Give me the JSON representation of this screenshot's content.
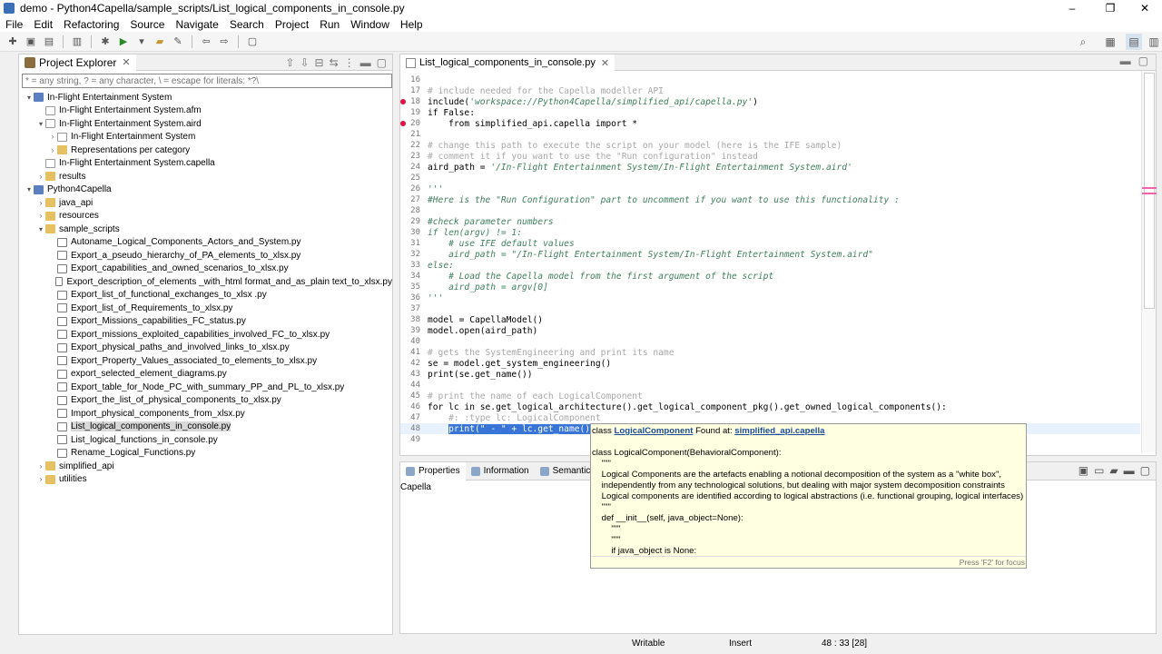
{
  "window": {
    "title": "demo - Python4Capella/sample_scripts/List_logical_components_in_console.py",
    "minimize": "–",
    "maximize": "❐",
    "close": "✕"
  },
  "menu": [
    "File",
    "Edit",
    "Refactoring",
    "Source",
    "Navigate",
    "Search",
    "Project",
    "Run",
    "Window",
    "Help"
  ],
  "project_explorer": {
    "tab_label": "Project Explorer",
    "filter_placeholder": "* = any string, ? = any character, \\ = escape for literals: *?\\",
    "tree": [
      {
        "label": "In-Flight Entertainment System",
        "depth": 0,
        "twisty": "▾",
        "icon": "proj"
      },
      {
        "label": "In-Flight Entertainment System.afm",
        "depth": 1,
        "twisty": "",
        "icon": "file"
      },
      {
        "label": "In-Flight Entertainment System.aird",
        "depth": 1,
        "twisty": "▾",
        "icon": "file"
      },
      {
        "label": "In-Flight Entertainment System",
        "depth": 2,
        "twisty": "›",
        "icon": "file"
      },
      {
        "label": "Representations per category",
        "depth": 2,
        "twisty": "›",
        "icon": "folder"
      },
      {
        "label": "In-Flight Entertainment System.capella",
        "depth": 1,
        "twisty": "",
        "icon": "file"
      },
      {
        "label": "results",
        "depth": 1,
        "twisty": "›",
        "icon": "folder"
      },
      {
        "label": "Python4Capella",
        "depth": 0,
        "twisty": "▾",
        "icon": "proj"
      },
      {
        "label": "java_api",
        "depth": 1,
        "twisty": "›",
        "icon": "folder"
      },
      {
        "label": "resources",
        "depth": 1,
        "twisty": "›",
        "icon": "folder"
      },
      {
        "label": "sample_scripts",
        "depth": 1,
        "twisty": "▾",
        "icon": "folder"
      },
      {
        "label": "Autoname_Logical_Components_Actors_and_System.py",
        "depth": 2,
        "twisty": "",
        "icon": "py"
      },
      {
        "label": "Export_a_pseudo_hierarchy_of_PA_elements_to_xlsx.py",
        "depth": 2,
        "twisty": "",
        "icon": "py"
      },
      {
        "label": "Export_capabilities_and_owned_scenarios_to_xlsx.py",
        "depth": 2,
        "twisty": "",
        "icon": "py"
      },
      {
        "label": "Export_description_of_elements _with_html format_and_as_plain text_to_xlsx.py",
        "depth": 2,
        "twisty": "",
        "icon": "py"
      },
      {
        "label": "Export_list_of_functional_exchanges_to_xlsx .py",
        "depth": 2,
        "twisty": "",
        "icon": "py"
      },
      {
        "label": "Export_list_of_Requirements_to_xlsx.py",
        "depth": 2,
        "twisty": "",
        "icon": "py"
      },
      {
        "label": "Export_Missions_capabilities_FC_status.py",
        "depth": 2,
        "twisty": "",
        "icon": "py"
      },
      {
        "label": "Export_missions_exploited_capabilities_involved_FC_to_xlsx.py",
        "depth": 2,
        "twisty": "",
        "icon": "py"
      },
      {
        "label": "Export_physical_paths_and_involved_links_to_xlsx.py",
        "depth": 2,
        "twisty": "",
        "icon": "py"
      },
      {
        "label": "Export_Property_Values_associated_to_elements_to_xlsx.py",
        "depth": 2,
        "twisty": "",
        "icon": "py"
      },
      {
        "label": "export_selected_element_diagrams.py",
        "depth": 2,
        "twisty": "",
        "icon": "py"
      },
      {
        "label": "Export_table_for_Node_PC_with_summary_PP_and_PL_to_xlsx.py",
        "depth": 2,
        "twisty": "",
        "icon": "py"
      },
      {
        "label": "Export_the_list_of_physical_components_to_xlsx.py",
        "depth": 2,
        "twisty": "",
        "icon": "py"
      },
      {
        "label": "Import_physical_components_from_xlsx.py",
        "depth": 2,
        "twisty": "",
        "icon": "py"
      },
      {
        "label": "List_logical_components_in_console.py",
        "depth": 2,
        "twisty": "",
        "icon": "py",
        "selected": true
      },
      {
        "label": "List_logical_functions_in_console.py",
        "depth": 2,
        "twisty": "",
        "icon": "py"
      },
      {
        "label": "Rename_Logical_Functions.py",
        "depth": 2,
        "twisty": "",
        "icon": "py"
      },
      {
        "label": "simplified_api",
        "depth": 1,
        "twisty": "›",
        "icon": "folder"
      },
      {
        "label": "utilities",
        "depth": 1,
        "twisty": "›",
        "icon": "folder"
      }
    ]
  },
  "editor": {
    "tab_label": "List_logical_components_in_console.py",
    "lines": [
      {
        "n": "16",
        "parts": [
          {
            "t": "",
            "c": ""
          }
        ]
      },
      {
        "n": "17",
        "parts": [
          {
            "t": "# include needed for the Capella modeller API",
            "c": "c-gray"
          }
        ]
      },
      {
        "n": "18",
        "marker": true,
        "parts": [
          {
            "t": "include(",
            "c": ""
          },
          {
            "t": "'workspace://Python4Capella/simplified_api/capella.py'",
            "c": "c-green"
          },
          {
            "t": ")",
            "c": ""
          }
        ]
      },
      {
        "n": "19",
        "parts": [
          {
            "t": "if False:",
            "c": ""
          }
        ]
      },
      {
        "n": "20",
        "marker": true,
        "parts": [
          {
            "t": "    from simplified_api.capella import *",
            "c": ""
          }
        ]
      },
      {
        "n": "21",
        "parts": [
          {
            "t": "",
            "c": ""
          }
        ]
      },
      {
        "n": "22",
        "parts": [
          {
            "t": "# change this path to execute the script on your model (here is the IFE sample)",
            "c": "c-gray"
          }
        ]
      },
      {
        "n": "23",
        "parts": [
          {
            "t": "# comment it if you want to use the \"Run configuration\" instead",
            "c": "c-gray"
          }
        ]
      },
      {
        "n": "24",
        "parts": [
          {
            "t": "aird_path = ",
            "c": ""
          },
          {
            "t": "'/In-Flight Entertainment System/In-Flight Entertainment System.aird'",
            "c": "c-green"
          }
        ]
      },
      {
        "n": "25",
        "parts": [
          {
            "t": "",
            "c": ""
          }
        ]
      },
      {
        "n": "26",
        "parts": [
          {
            "t": "'''",
            "c": "c-green"
          }
        ]
      },
      {
        "n": "27",
        "parts": [
          {
            "t": "#Here is the \"Run Configuration\" part to uncomment if you want to use this functionality :",
            "c": "c-green"
          }
        ]
      },
      {
        "n": "28",
        "parts": [
          {
            "t": "",
            "c": ""
          }
        ]
      },
      {
        "n": "29",
        "parts": [
          {
            "t": "#check parameter numbers",
            "c": "c-green"
          }
        ]
      },
      {
        "n": "30",
        "parts": [
          {
            "t": "if len(argv) != 1:",
            "c": "c-green"
          }
        ]
      },
      {
        "n": "31",
        "parts": [
          {
            "t": "    # use IFE default values",
            "c": "c-green"
          }
        ]
      },
      {
        "n": "32",
        "parts": [
          {
            "t": "    aird_path = \"/In-Flight Entertainment System/In-Flight Entertainment System.aird\"",
            "c": "c-green"
          }
        ]
      },
      {
        "n": "33",
        "parts": [
          {
            "t": "else:",
            "c": "c-green"
          }
        ]
      },
      {
        "n": "34",
        "parts": [
          {
            "t": "    # Load the Capella model from the first argument of the script",
            "c": "c-green"
          }
        ]
      },
      {
        "n": "35",
        "parts": [
          {
            "t": "    aird_path = argv[0]",
            "c": "c-green"
          }
        ]
      },
      {
        "n": "36",
        "parts": [
          {
            "t": "'''",
            "c": "c-green"
          }
        ]
      },
      {
        "n": "37",
        "parts": [
          {
            "t": "",
            "c": ""
          }
        ]
      },
      {
        "n": "38",
        "parts": [
          {
            "t": "model = CapellaModel()",
            "c": ""
          }
        ]
      },
      {
        "n": "39",
        "parts": [
          {
            "t": "model.open(aird_path)",
            "c": ""
          }
        ]
      },
      {
        "n": "40",
        "parts": [
          {
            "t": "",
            "c": ""
          }
        ]
      },
      {
        "n": "41",
        "parts": [
          {
            "t": "# gets the SystemEngineering and print its name",
            "c": "c-gray"
          }
        ]
      },
      {
        "n": "42",
        "parts": [
          {
            "t": "se = model.get_system_engineering()",
            "c": ""
          }
        ]
      },
      {
        "n": "43",
        "parts": [
          {
            "t": "print(se.get_name())",
            "c": ""
          }
        ]
      },
      {
        "n": "44",
        "parts": [
          {
            "t": "",
            "c": ""
          }
        ]
      },
      {
        "n": "45",
        "parts": [
          {
            "t": "# print the name of each LogicalComponent",
            "c": "c-gray"
          }
        ]
      },
      {
        "n": "46",
        "parts": [
          {
            "t": "for lc in se.get_logical_architecture().get_logical_component_pkg().get_owned_logical_components():",
            "c": ""
          }
        ]
      },
      {
        "n": "47",
        "parts": [
          {
            "t": "    #: :type lc: LogicalComponent",
            "c": "c-gray"
          }
        ]
      },
      {
        "n": "48",
        "cur": true,
        "parts": [
          {
            "t": "    ",
            "c": ""
          },
          {
            "t": "print(\" - \" + lc.get_name())",
            "c": "sel"
          }
        ]
      },
      {
        "n": "49",
        "parts": [
          {
            "t": "",
            "c": ""
          }
        ]
      }
    ]
  },
  "bottom_panel": {
    "tabs": [
      "Properties",
      "Information",
      "Semantic Bro"
    ],
    "content": "Capella"
  },
  "hover_popup": {
    "prefix": "class ",
    "class_link": "LogicalComponent",
    "found_at": " Found at: ",
    "module_link": "simplified_api.capella",
    "body": "class LogicalComponent(BehavioralComponent):\n    \"\"\"\n    Logical Components are the artefacts enabling a notional decomposition of the system as a \"white box\",\n    independently from any technological solutions, but dealing with major system decomposition constraints\n    Logical components are identified according to logical abstractions (i.e. functional grouping, logical interfaces)\n    \"\"\"\n    def __init__(self, java_object=None):\n        \"\"\"\n        \"\"\"\n        if java_object is None:",
    "footer": "Press 'F2' for focus"
  },
  "status_bar": {
    "mode": "Writable",
    "insert": "Insert",
    "position": "48 : 33 [28]"
  }
}
